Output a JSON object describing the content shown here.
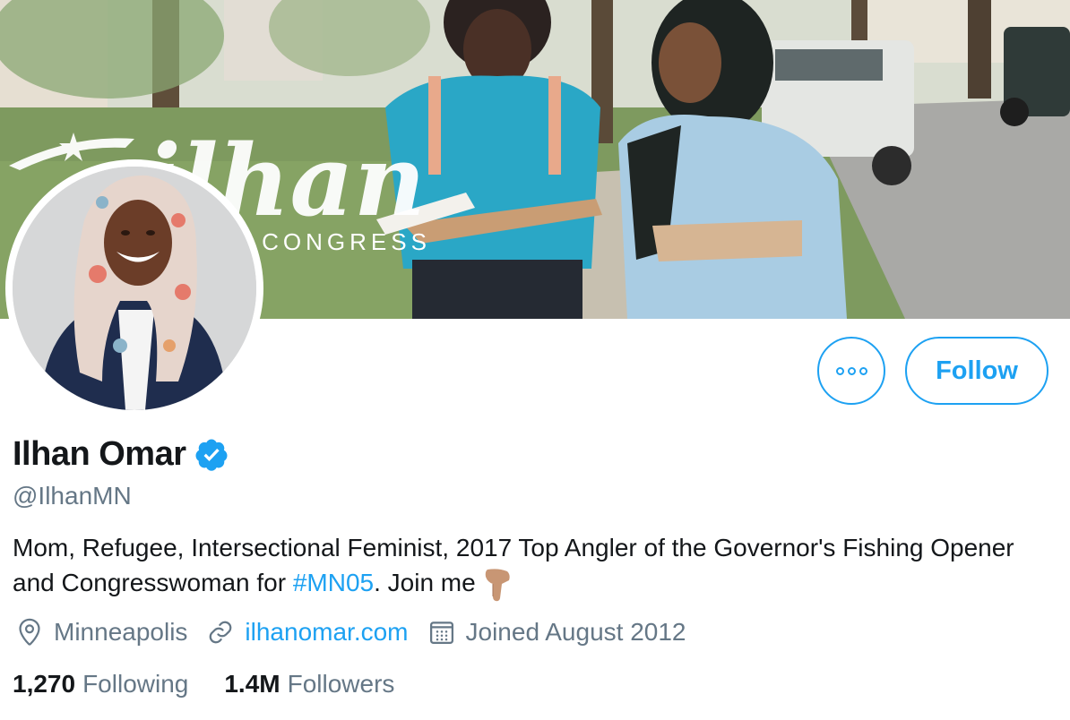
{
  "banner": {
    "logo_text": "ilhan",
    "logo_subtext": "FOR CONGRESS"
  },
  "actions": {
    "more_label": "More",
    "follow_label": "Follow"
  },
  "profile": {
    "name": "Ilhan Omar",
    "handle": "@IlhanMN",
    "verified": true,
    "bio_text": "Mom, Refugee, Intersectional Feminist, 2017 Top Angler of the Governor's Fishing Opener and Congresswoman for ",
    "bio_hashtag": "#MN05",
    "bio_tail": ". Join me",
    "bio_emoji": "pointing-down-emoji",
    "location": "Minneapolis",
    "website": "ilhanomar.com",
    "joined": "Joined August 2012"
  },
  "stats": {
    "following_count": "1,270",
    "following_label": "Following",
    "followers_count": "1.4M",
    "followers_label": "Followers"
  },
  "colors": {
    "accent": "#1da1f2",
    "text": "#14171a",
    "secondary": "#657786"
  },
  "icons": {
    "verified": "verified-badge-icon",
    "more": "more-dots-icon",
    "location": "location-pin-icon",
    "link": "link-icon",
    "calendar": "calendar-icon"
  }
}
